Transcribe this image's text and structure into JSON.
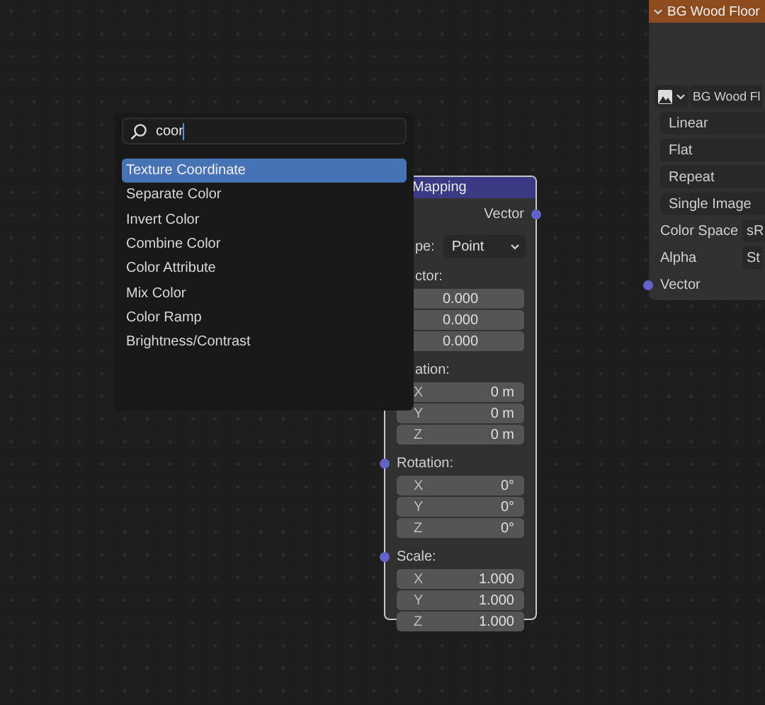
{
  "search": {
    "query": "coor"
  },
  "results": [
    {
      "label": "Texture Coordinate",
      "selected": true
    },
    {
      "label": "Separate Color",
      "selected": false
    },
    {
      "label": "Invert Color",
      "selected": false
    },
    {
      "label": "Combine Color",
      "selected": false
    },
    {
      "label": "Color Attribute",
      "selected": false
    },
    {
      "label": "Mix Color",
      "selected": false
    },
    {
      "label": "Color Ramp",
      "selected": false
    },
    {
      "label": "Brightness/Contrast",
      "selected": false
    }
  ],
  "mapping_node": {
    "title": "Mapping",
    "output": "Vector",
    "type_label": "pe:",
    "type_value": "Point",
    "sections": [
      {
        "label": "ctor:",
        "socket": false,
        "rows": [
          {
            "axis": "",
            "value": "0.000"
          },
          {
            "axis": "",
            "value": "0.000"
          },
          {
            "axis": "",
            "value": "0.000"
          }
        ]
      },
      {
        "label": "ation:",
        "socket": false,
        "rows": [
          {
            "axis": "X",
            "value": "0 m"
          },
          {
            "axis": "Y",
            "value": "0 m"
          },
          {
            "axis": "Z",
            "value": "0 m"
          }
        ]
      },
      {
        "label": "Rotation:",
        "socket": true,
        "rows": [
          {
            "axis": "X",
            "value": "0°"
          },
          {
            "axis": "Y",
            "value": "0°"
          },
          {
            "axis": "Z",
            "value": "0°"
          }
        ]
      },
      {
        "label": "Scale:",
        "socket": true,
        "rows": [
          {
            "axis": "X",
            "value": "1.000"
          },
          {
            "axis": "Y",
            "value": "1.000"
          },
          {
            "axis": "Z",
            "value": "1.000"
          }
        ]
      }
    ]
  },
  "image_node": {
    "title": "BG Wood Floor",
    "image": "BG Wood Fl",
    "dropdowns": [
      "Linear",
      "Flat",
      "Repeat",
      "Single Image"
    ],
    "properties": [
      {
        "label": "Color Space",
        "value": "sR"
      },
      {
        "label": "Alpha",
        "value": "St"
      }
    ],
    "input": "Vector"
  }
}
